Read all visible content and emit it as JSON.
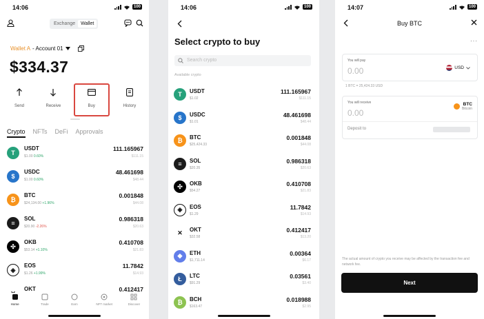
{
  "colors": {
    "usdt": "#26a17b",
    "usdc": "#2775ca",
    "btc": "#f7931a",
    "sol": "#1b1b1b",
    "okb": "#000000",
    "eos": "#000000",
    "okt": "#ffffff",
    "eth": "#627eea",
    "ltc": "#345d9d",
    "bch": "#8dc351",
    "highlight": "#d9473f",
    "wallet_accent": "#e8912b"
  },
  "panel1": {
    "time": "14:06",
    "battery": "100",
    "segments": [
      "Exchange",
      "Wallet"
    ],
    "wallet_name": "Wallet A",
    "account": "- Account 01",
    "balance": "$334.37",
    "actions": [
      {
        "label": "Send",
        "icon": "arrow-up-icon"
      },
      {
        "label": "Receive",
        "icon": "arrow-down-icon"
      },
      {
        "label": "Buy",
        "icon": "card-icon"
      },
      {
        "label": "History",
        "icon": "document-icon"
      }
    ],
    "tabs": [
      "Crypto",
      "NFTs",
      "DeFi",
      "Approvals"
    ],
    "assets": [
      {
        "symbol": "USDT",
        "price": "$1.00",
        "change": "0.60%",
        "dir": "up",
        "amount": "111.165967",
        "fiat": "$111.15"
      },
      {
        "symbol": "USDC",
        "price": "$1.00",
        "change": "0.60%",
        "dir": "up",
        "amount": "48.461698",
        "fiat": "$48.44"
      },
      {
        "symbol": "BTC",
        "price": "$24,134.00",
        "change": "+1.96%",
        "dir": "up",
        "amount": "0.001848",
        "fiat": "$44.08"
      },
      {
        "symbol": "SOL",
        "price": "$20.90",
        "change": "-2.26%",
        "dir": "down",
        "amount": "0.986318",
        "fiat": "$20.63"
      },
      {
        "symbol": "OKB",
        "price": "$53.14",
        "change": "+1.10%",
        "dir": "up",
        "amount": "0.410708",
        "fiat": "$21.83"
      },
      {
        "symbol": "EOS",
        "price": "$1.26",
        "change": "+1.99%",
        "dir": "up",
        "amount": "11.7842",
        "fiat": "$14.93"
      },
      {
        "symbol": "OKT",
        "price": "",
        "change": "",
        "dir": "up",
        "amount": "0.412417",
        "fiat": ""
      }
    ],
    "nav": [
      "Home",
      "Trade",
      "Earn",
      "NFT market",
      "Discover"
    ]
  },
  "panel2": {
    "time": "14:06",
    "battery": "100",
    "title": "Select crypto to buy",
    "search_placeholder": "Search crypto",
    "section": "Available crypto",
    "list": [
      {
        "symbol": "USDT",
        "price": "$1.02",
        "amount": "111.165967",
        "fiat": "$111.15"
      },
      {
        "symbol": "USDC",
        "price": "$1.01",
        "amount": "48.461698",
        "fiat": "$48.44"
      },
      {
        "symbol": "BTC",
        "price": "$25,424.33",
        "amount": "0.001848",
        "fiat": "$44.08"
      },
      {
        "symbol": "SOL",
        "price": "$20.35",
        "amount": "0.986318",
        "fiat": "$20.63"
      },
      {
        "symbol": "OKB",
        "price": "$54.27",
        "amount": "0.410708",
        "fiat": "$21.83"
      },
      {
        "symbol": "EOS",
        "price": "$1.29",
        "amount": "11.7842",
        "fiat": "$14.93"
      },
      {
        "symbol": "OKT",
        "price": "$32.58",
        "amount": "0.412417",
        "fiat": "$13.20"
      },
      {
        "symbol": "ETH",
        "price": "$1,711.14",
        "amount": "0.00364",
        "fiat": "$6.17"
      },
      {
        "symbol": "LTC",
        "price": "$91.29",
        "amount": "0.03561",
        "fiat": "$3.40"
      },
      {
        "symbol": "BCH",
        "price": "$163.47",
        "amount": "0.018988",
        "fiat": "$2.95"
      }
    ]
  },
  "panel3": {
    "time": "14:07",
    "battery": "100",
    "title": "Buy BTC",
    "pay_label": "You will pay",
    "pay_value": "0.00",
    "fiat_currency": "USD",
    "rate": "1 BTC = 25,424.33 USD",
    "receive_label": "You will receive",
    "receive_value": "0.00",
    "coin_symbol": "BTC",
    "coin_name": "Bitcoin",
    "deposit_label": "Deposit to",
    "note": "The actual amount of crypto you receive may be affected by the transaction fee and network fee.",
    "next_label": "Next"
  }
}
